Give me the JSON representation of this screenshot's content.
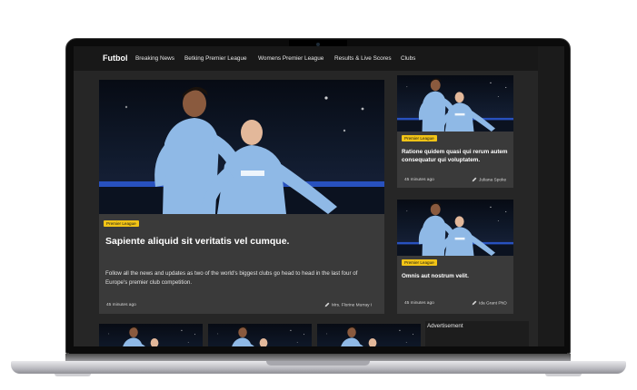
{
  "site": {
    "brand": "Futbol",
    "nav_items": [
      "Breaking News",
      "Betking Premier League",
      "Womens Premier League",
      "Results & Live Scores",
      "Clubs"
    ]
  },
  "hero": {
    "tag": "Premier League",
    "title": "Sapiente aliquid sit veritatis vel cumque.",
    "description": "Follow all the news and updates as two of the world's biggest clubs go head to head in the last four of Europe's premier club competition.",
    "time": "45 minutes ago",
    "author": "Mrs. Florine Murray I"
  },
  "cards": [
    {
      "tag": "Premier League",
      "title": "Ratione quidem quasi qui rerum autem consequatur qui voluptatem.",
      "time": "45 minutes ago",
      "author": "Juliana Spoke"
    },
    {
      "tag": "Premier League",
      "title": "Omnis aut nostrum velit.",
      "time": "45 minutes ago",
      "author": "Ida Grant PhD"
    }
  ],
  "advertisement": {
    "label": "Advertisement"
  },
  "colors": {
    "tag_bg": "#f2c416",
    "kit_blue": "#8fb9e6",
    "card_bg": "#3a3a3a",
    "nav_bg": "#181818"
  },
  "icons": {
    "author": "pen-icon"
  }
}
